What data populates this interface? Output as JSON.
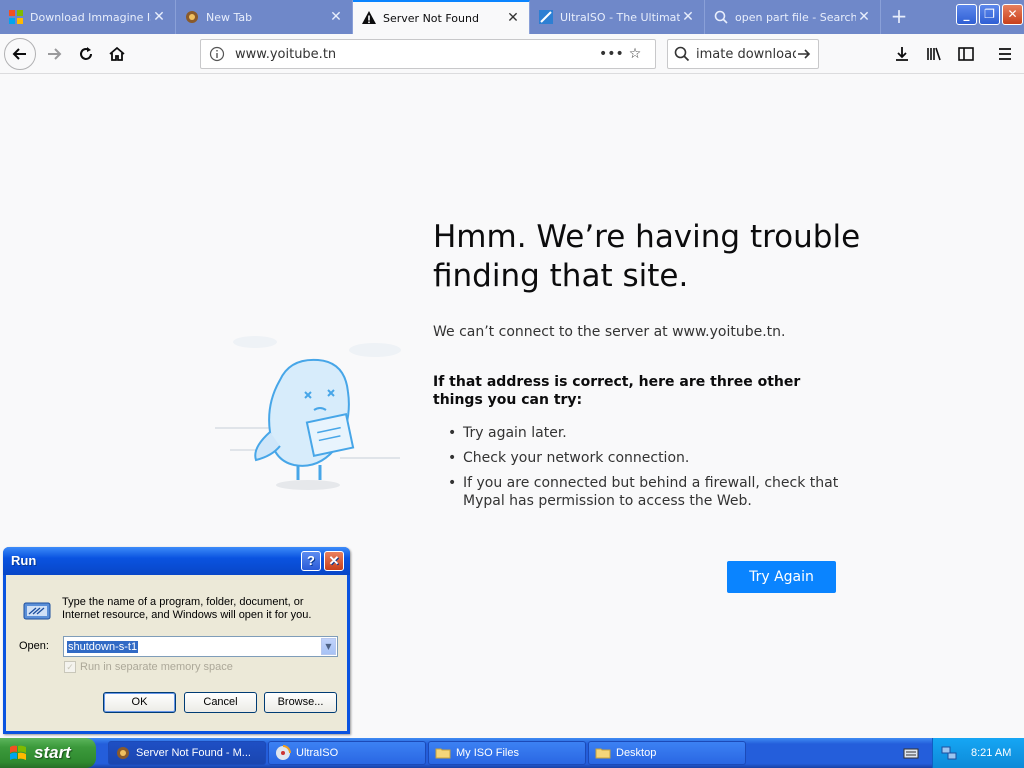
{
  "browser": {
    "tabs": [
      {
        "label": "Download Immagine ISO",
        "active": false
      },
      {
        "label": "New Tab",
        "active": false
      },
      {
        "label": "Server Not Found",
        "active": true
      },
      {
        "label": "UltraISO - The Ultimate",
        "active": false
      },
      {
        "label": "open part file - Search",
        "active": false
      }
    ],
    "window_buttons": {
      "minimize": "_",
      "restore": "❐",
      "close": "✕"
    },
    "url": "www.yoitube.tn",
    "search_query": "imate download"
  },
  "error_page": {
    "title": "Hmm. We’re having trouble finding that site.",
    "message": "We can’t connect to the server at www.yoitube.tn.",
    "subtitle": "If that address is correct, here are three other things you can try:",
    "tips": [
      "Try again later.",
      "Check your network connection.",
      "If you are connected but behind a firewall, check that Mypal has permission to access the Web."
    ],
    "try_again_label": "Try Again"
  },
  "run_dialog": {
    "title": "Run",
    "description": "Type the name of a program, folder, document, or Internet resource, and Windows will open it for you.",
    "open_label": "Open:",
    "open_value": "shutdown-s-t1",
    "checkbox_label": "Run in separate memory space",
    "buttons": {
      "ok": "OK",
      "cancel": "Cancel",
      "browse": "Browse..."
    }
  },
  "taskbar": {
    "start_label": "start",
    "items": [
      {
        "label": "Server Not Found - M..."
      },
      {
        "label": "UltraISO"
      },
      {
        "label": "My ISO Files"
      },
      {
        "label": "Desktop"
      }
    ],
    "clock": "8:21 AM"
  },
  "colors": {
    "accent": "#0a84ff",
    "tabstrip": "#6f88c9",
    "xp_blue": "#245edb",
    "start_green": "#3c9a3c"
  },
  "icons": [
    "windows-logo-icon",
    "mypal-icon",
    "warning-icon",
    "ultraiso-icon",
    "search-icon",
    "back-icon",
    "forward-icon",
    "reload-icon",
    "home-icon",
    "info-icon",
    "more-icon",
    "star-icon",
    "go-arrow-icon",
    "download-icon",
    "library-icon",
    "sidebar-icon",
    "menu-icon",
    "run-icon",
    "folder-icon",
    "keyboard-icon",
    "network-icon"
  ]
}
